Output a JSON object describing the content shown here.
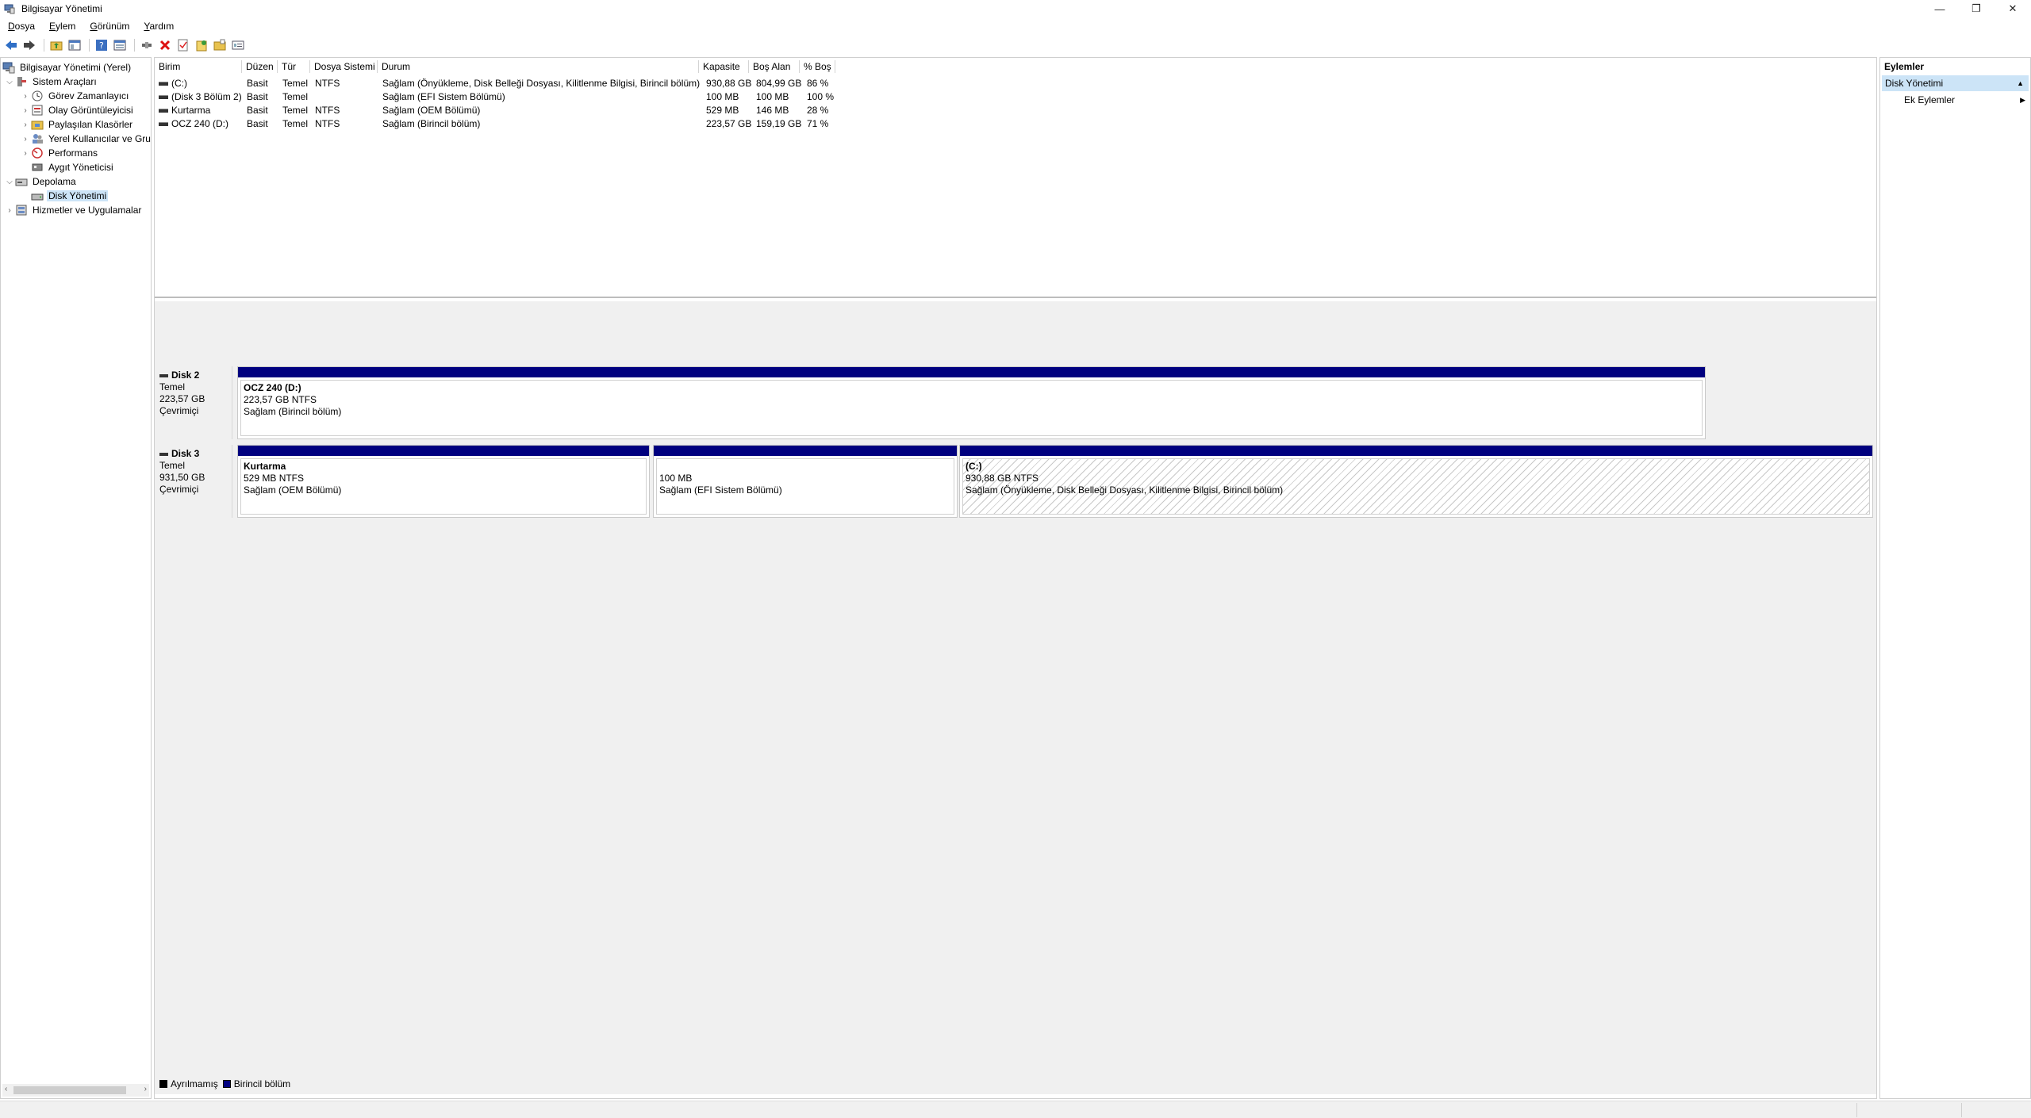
{
  "window": {
    "title": "Bilgisayar Yönetimi",
    "minimize_glyph": "—",
    "restore_glyph": "❐",
    "close_glyph": "✕"
  },
  "menu": [
    {
      "ul": "D",
      "rest": "osya"
    },
    {
      "ul": "E",
      "rest": "ylem"
    },
    {
      "ul": "G",
      "rest": "örünüm"
    },
    {
      "ul": "Y",
      "rest": "ardım"
    }
  ],
  "tree": {
    "root": "Bilgisayar Yönetimi (Yerel)",
    "system_tools": "Sistem Araçları",
    "task_scheduler": "Görev Zamanlayıcı",
    "event_viewer": "Olay Görüntüleyicisi",
    "shared_folders": "Paylaşılan Klasörler",
    "local_users": "Yerel Kullanıcılar ve Gru",
    "performance": "Performans",
    "device_manager": "Aygıt Yöneticisi",
    "storage": "Depolama",
    "disk_management": "Disk Yönetimi",
    "services": "Hizmetler ve Uygulamalar"
  },
  "volume_table": {
    "headers": [
      "Birim",
      "Düzen",
      "Tür",
      "Dosya Sistemi",
      "Durum",
      "Kapasite",
      "Boş Alan",
      "% Boş"
    ],
    "rows": [
      [
        "(C:)",
        "Basit",
        "Temel",
        "NTFS",
        "Sağlam (Önyükleme, Disk Belleği Dosyası, Kilitlenme Bilgisi, Birincil bölüm)",
        "930,88 GB",
        "804,99 GB",
        "86 %"
      ],
      [
        "(Disk 3 Bölüm 2)",
        "Basit",
        "Temel",
        "",
        "Sağlam (EFI Sistem Bölümü)",
        "100 MB",
        "100 MB",
        "100 %"
      ],
      [
        "Kurtarma",
        "Basit",
        "Temel",
        "NTFS",
        "Sağlam (OEM Bölümü)",
        "529 MB",
        "146 MB",
        "28 %"
      ],
      [
        "OCZ 240 (D:)",
        "Basit",
        "Temel",
        "NTFS",
        "Sağlam (Birincil bölüm)",
        "223,57 GB",
        "159,19 GB",
        "71 %"
      ]
    ]
  },
  "disks": [
    {
      "name": "Disk 2",
      "type": "Temel",
      "size": "223,57 GB",
      "status": "Çevrimiçi",
      "partitions": [
        {
          "name": "OCZ 240  (D:)",
          "size": "223,57 GB NTFS",
          "status": "Sağlam (Birincil bölüm)"
        }
      ]
    },
    {
      "name": "Disk 3",
      "type": "Temel",
      "size": "931,50 GB",
      "status": "Çevrimiçi",
      "partitions": [
        {
          "name": "Kurtarma",
          "size": "529 MB NTFS",
          "status": "Sağlam (OEM Bölümü)"
        },
        {
          "name": "",
          "size": "100 MB",
          "status": "Sağlam (EFI Sistem Bölümü)"
        },
        {
          "name": "(C:)",
          "size": "930,88 GB NTFS",
          "status": "Sağlam (Önyükleme, Disk Belleği Dosyası, Kilitlenme Bilgisi, Birincil bölüm)"
        }
      ]
    }
  ],
  "legend": {
    "unallocated": "Ayrılmamış",
    "primary": "Birincil bölüm",
    "unallocated_color": "#000000",
    "primary_color": "#00007f"
  },
  "actions": {
    "header": "Eylemler",
    "section": "Disk Yönetimi",
    "more": "Ek Eylemler"
  },
  "icons": {
    "back": "back-arrow-icon",
    "forward": "forward-arrow-icon",
    "up": "up-folder-icon",
    "properties": "properties-icon",
    "help": "help-icon",
    "console": "console-tree-icon",
    "connect": "connect-icon",
    "delete": "delete-icon",
    "check": "check-icon",
    "new_volume": "new-volume-icon",
    "folder": "folder-icon",
    "properties2": "properties-window-icon"
  }
}
